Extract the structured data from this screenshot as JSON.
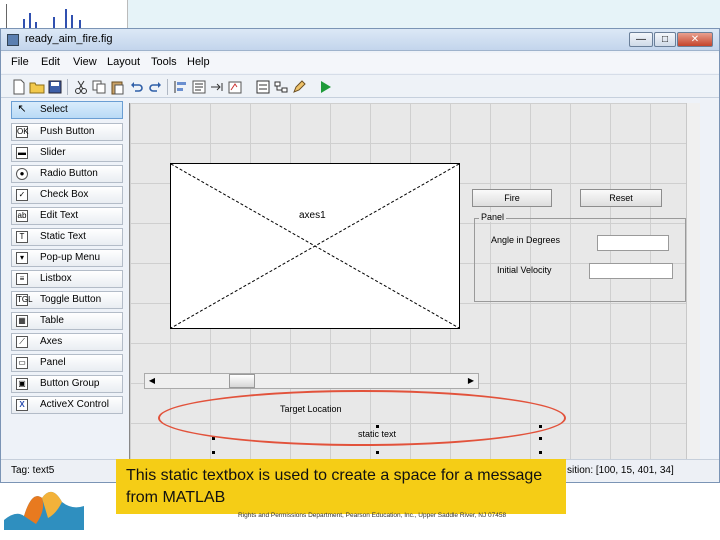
{
  "window": {
    "title": "ready_aim_fire.fig",
    "controls": {
      "minimize": "—",
      "maximize": "□",
      "close": "✕"
    }
  },
  "menu": [
    "File",
    "Edit",
    "View",
    "Layout",
    "Tools",
    "Help"
  ],
  "toolbar": {
    "icons": [
      "new-icon",
      "open-icon",
      "save-icon",
      "cut-icon",
      "copy-icon",
      "paste-icon",
      "undo-icon",
      "redo-icon",
      "align-icon",
      "menu-editor-icon",
      "tab-order-icon",
      "mfile-editor-icon",
      "property-inspector-icon",
      "object-browser-icon",
      "run-icon"
    ]
  },
  "palette": [
    {
      "label": "Select",
      "icon": "arrow-icon"
    },
    {
      "label": "Push Button",
      "icon": "push-button-icon"
    },
    {
      "label": "Slider",
      "icon": "slider-icon"
    },
    {
      "label": "Radio Button",
      "icon": "radio-button-icon"
    },
    {
      "label": "Check Box",
      "icon": "check-box-icon"
    },
    {
      "label": "Edit Text",
      "icon": "edit-text-icon"
    },
    {
      "label": "Static Text",
      "icon": "static-text-icon"
    },
    {
      "label": "Pop-up Menu",
      "icon": "popup-menu-icon"
    },
    {
      "label": "Listbox",
      "icon": "listbox-icon"
    },
    {
      "label": "Toggle Button",
      "icon": "toggle-button-icon"
    },
    {
      "label": "Table",
      "icon": "table-icon"
    },
    {
      "label": "Axes",
      "icon": "axes-icon"
    },
    {
      "label": "Panel",
      "icon": "panel-icon"
    },
    {
      "label": "Button Group",
      "icon": "button-group-icon"
    },
    {
      "label": "ActiveX Control",
      "icon": "activex-icon"
    }
  ],
  "canvas": {
    "axes_label": "axes1",
    "fire_button": "Fire",
    "reset_button": "Reset",
    "panel_title": "Panel",
    "angle_label": "Angle in Degrees",
    "velocity_label": "Initial Velocity",
    "target_label": "Target Location",
    "static_text": "static text"
  },
  "status": {
    "tag": "Tag: text5",
    "position": "sition: [100, 15, 401, 34]"
  },
  "callout": "This static textbox is used to create a space for a message from MATLAB",
  "credit": "Rights and Permissions Department, Pearson Education, Inc., Upper Saddle River, NJ 07458",
  "colors": {
    "callout_bg": "#f5cd16",
    "highlight_oval": "#e2523b",
    "selected_tool": "#b9daf6"
  }
}
